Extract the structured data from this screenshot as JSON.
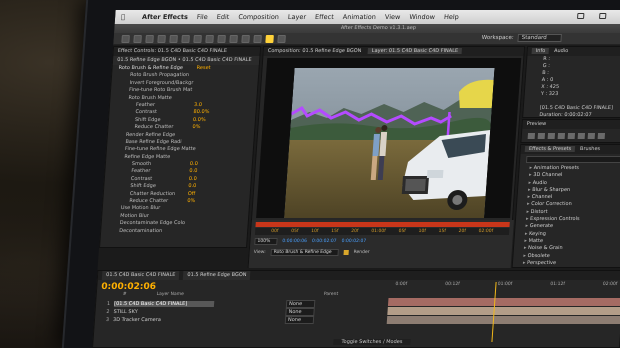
{
  "menubar": {
    "apple": "",
    "items": [
      "After Effects",
      "File",
      "Edit",
      "Composition",
      "Layer",
      "Effect",
      "Animation",
      "View",
      "Window",
      "Help"
    ]
  },
  "window": {
    "title": "After Effects Demo v1.3.1.aep"
  },
  "workspace": {
    "label": "Workspace:",
    "value": "Standard"
  },
  "effect_controls": {
    "tab": "Effect Controls: 01.5 C4D Basic C4D FINALE",
    "path": "01.5 Refine Edge BGON • 01.5 C4D Basic C4D FINALE",
    "rows": [
      {
        "label": "Roto Brush & Refine Edge",
        "value": "Reset",
        "cls": "head"
      },
      {
        "label": "Roto Brush Propagation",
        "value": "",
        "cls": "sub"
      },
      {
        "label": "Invert Foreground/Backgr",
        "value": "",
        "cls": "sub"
      },
      {
        "label": "Fine-tune Roto Brush Mat",
        "value": "",
        "cls": "sub"
      },
      {
        "label": "Roto Brush Matte",
        "value": "",
        "cls": "sub"
      },
      {
        "label": "Feather",
        "value": "3.0",
        "cls": "sub2"
      },
      {
        "label": "Contrast",
        "value": "80.0%",
        "cls": "sub2"
      },
      {
        "label": "Shift Edge",
        "value": "0.0%",
        "cls": "sub2"
      },
      {
        "label": "Reduce Chatter",
        "value": "0%",
        "cls": "sub2"
      },
      {
        "label": "Render Refine Edge",
        "value": "",
        "cls": "sub"
      },
      {
        "label": "Base Refine Edge Radi",
        "value": "",
        "cls": "sub"
      },
      {
        "label": "Fine-tune Refine Edge Matte",
        "value": "",
        "cls": "sub"
      },
      {
        "label": "Refine Edge Matte",
        "value": "",
        "cls": "sub"
      },
      {
        "label": "Smooth",
        "value": "0.0",
        "cls": "sub2"
      },
      {
        "label": "Feather",
        "value": "0.0",
        "cls": "sub2"
      },
      {
        "label": "Contrast",
        "value": "0.0",
        "cls": "sub2"
      },
      {
        "label": "Shift Edge",
        "value": "0.0",
        "cls": "sub2"
      },
      {
        "label": "Chatter Reduction",
        "value": "Off",
        "cls": "sub2"
      },
      {
        "label": "Reduce Chatter",
        "value": "0%",
        "cls": "sub2"
      },
      {
        "label": "Use Motion Blur",
        "value": "",
        "cls": "sub"
      },
      {
        "label": "Motion Blur",
        "value": "",
        "cls": "sub"
      },
      {
        "label": "Decontaminate Edge Colo",
        "value": "",
        "cls": "sub"
      },
      {
        "label": "Decontamination",
        "value": "",
        "cls": "sub"
      }
    ]
  },
  "composition": {
    "tab": "Composition: 01.5 Refine Edge BGON",
    "layer_tab": "Layer: 01.5 C4D Basic C4D FINALE",
    "ruler": [
      "00f",
      "05f",
      "10f",
      "15f",
      "20f",
      "01:00f",
      "05f",
      "10f",
      "15f",
      "20f",
      "02:00f"
    ],
    "zoom": "100%",
    "timecode": "0:00:00:06",
    "timecode_end": "0:00:02:07",
    "duration": "0:00:02:07",
    "view_label": "View:",
    "view_value": "Roto Brush & Refine Edge",
    "render_label": "Render"
  },
  "info": {
    "tab": "Info",
    "audio_tab": "Audio",
    "lines": [
      "R :",
      "G :",
      "B :",
      "A : 0",
      "X : 425",
      "Y : 323",
      "",
      "[01.5 C4D Basic C4D FINALE]",
      "Duration: 0:00:02:07"
    ]
  },
  "preview": {
    "tab": "Preview"
  },
  "effects_presets": {
    "tab": "Effects & Presets",
    "brushes_tab": "Brushes",
    "categories": [
      "Animation Presets",
      "3D Channel",
      "Audio",
      "Blur & Sharpen",
      "Channel",
      "Color Correction",
      "Distort",
      "Expression Controls",
      "Generate",
      "Keying",
      "Matte",
      "Noise & Grain",
      "Obsolete",
      "Perspective"
    ]
  },
  "timeline": {
    "tabs": [
      "01.5 C4D Basic C4D FINALE",
      "01.5 Refine Edge BGON"
    ],
    "timecode": "0:00:02:06",
    "headers": [
      "#",
      "Layer Name",
      "Parent"
    ],
    "layers": [
      {
        "num": "1",
        "name": "[01.5 C4D Basic C4D FINALE]",
        "mode": "None",
        "selected": true
      },
      {
        "num": "2",
        "name": "STILL SKY",
        "mode": "None",
        "selected": false
      },
      {
        "num": "3",
        "name": "3D Tracker Camera",
        "mode": "None",
        "selected": false
      }
    ],
    "ruler": [
      "0:00f",
      "00:12f",
      "01:00f",
      "01:12f",
      "02:00f"
    ],
    "toggle": "Toggle Switches / Modes"
  },
  "colors": {
    "accent_orange": "#ffb000",
    "roto_outline": "#b44bff",
    "timeline_red": "#c9361a"
  }
}
